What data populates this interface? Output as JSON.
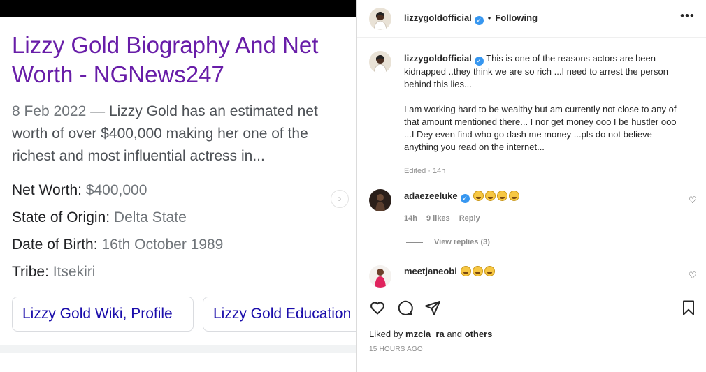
{
  "search_result": {
    "title": "Lizzy Gold Biography And Net Worth - NGNews247",
    "date": "8 Feb 2022",
    "separator": "—",
    "snippet": "Lizzy Gold has an estimated net worth of over $400,000 making her one of the richest and most influential actress in...",
    "facts": [
      {
        "label": "Net Worth:",
        "value": "$400,000"
      },
      {
        "label": "State of Origin:",
        "value": "Delta State"
      },
      {
        "label": "Date of Birth:",
        "value": "16th October 1989"
      },
      {
        "label": "Tribe:",
        "value": "Itsekiri"
      }
    ],
    "chips": [
      "Lizzy Gold Wiki, Profile",
      "Lizzy Gold Education"
    ]
  },
  "post": {
    "header": {
      "username": "lizzygoldofficial",
      "separator": "•",
      "follow_status": "Following"
    },
    "caption": {
      "username": "lizzygoldofficial",
      "paragraph1": "This is one of the reasons actors are been kidnapped ..they think we are so rich ...I need to arrest the person behind this lies...",
      "paragraph2": "I am working hard to be wealthy but am currently not close to any of that amount mentioned there... I nor get money ooo I be hustler ooo ...I Dey even find who go dash me money ...pls do not believe anything you read on the internet...",
      "meta": "Edited · 14h"
    },
    "comments": [
      {
        "username": "adaezeeluke",
        "emoji_count": 4,
        "time": "14h",
        "likes": "9 likes",
        "reply": "Reply",
        "view_replies": "View replies (3)"
      },
      {
        "username": "meetjaneobi",
        "emoji_count": 3
      }
    ],
    "liked_by": {
      "prefix": "Liked by",
      "user": "mzcla_ra",
      "and": "and",
      "others": "others"
    },
    "timestamp": "15 HOURS AGO"
  },
  "icons": [
    "verified-badge-icon",
    "more-options-icon",
    "heart-icon",
    "comment-icon",
    "share-icon",
    "bookmark-icon",
    "chevron-right-icon",
    "laughing-emoji-icon"
  ],
  "colors": {
    "link_visited": "#681da8",
    "link": "#1a0dab",
    "verified": "#3797f0",
    "text": "#262626",
    "muted": "#8e8e8e"
  }
}
